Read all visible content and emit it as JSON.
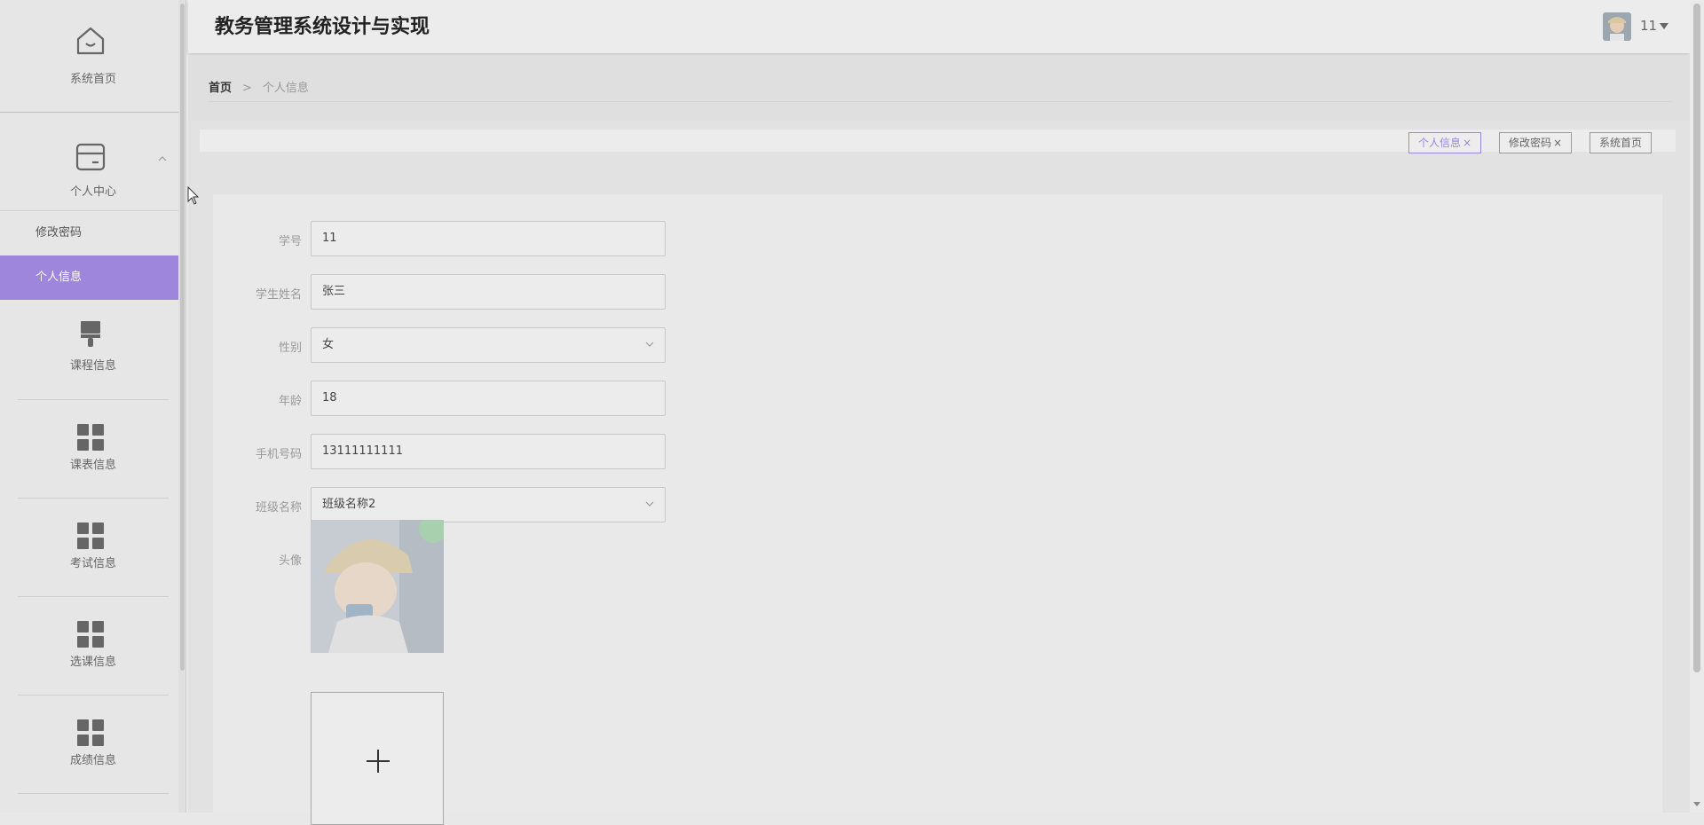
{
  "app": {
    "title": "教务管理系统设计与实现"
  },
  "user": {
    "name": "11"
  },
  "sidebar": {
    "home": {
      "label": "系统首页",
      "icon": "home-icon"
    },
    "personal": {
      "label": "个人中心",
      "icon": "card-icon",
      "expanded": true,
      "items": [
        {
          "label": "修改密码",
          "active": false
        },
        {
          "label": "个人信息",
          "active": true
        }
      ]
    },
    "menus": [
      {
        "label": "课程信息",
        "icon": "brush-icon"
      },
      {
        "label": "课表信息",
        "icon": "grid-icon"
      },
      {
        "label": "考试信息",
        "icon": "grid-icon"
      },
      {
        "label": "选课信息",
        "icon": "grid-icon"
      },
      {
        "label": "成绩信息",
        "icon": "grid-icon"
      }
    ]
  },
  "breadcrumb": {
    "home": "首页",
    "separator": ">",
    "current": "个人信息"
  },
  "tags": [
    {
      "label": "个人信息",
      "close": "×",
      "active": true
    },
    {
      "label": "修改密码",
      "close": "×",
      "active": false
    },
    {
      "label": "系统首页",
      "active": false
    }
  ],
  "form": {
    "student_no": {
      "label": "学号",
      "value": "11"
    },
    "name": {
      "label": "学生姓名",
      "value": "张三"
    },
    "gender": {
      "label": "性别",
      "value": "女"
    },
    "age": {
      "label": "年龄",
      "value": "18"
    },
    "phone": {
      "label": "手机号码",
      "value": "13111111111"
    },
    "class_name": {
      "label": "班级名称",
      "value": "班级名称2"
    },
    "avatar": {
      "label": "头像"
    }
  },
  "colors": {
    "accent": "#9d86dc",
    "sidebar_bg": "#e6e6e6"
  }
}
